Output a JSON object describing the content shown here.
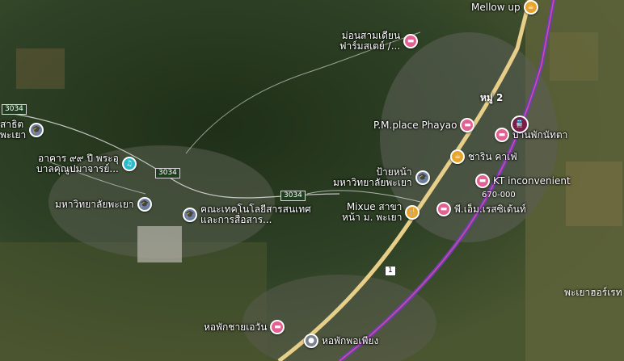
{
  "colors": {
    "hotel": "#e26191",
    "education": "#6d7f9c",
    "food": "#e8a32b",
    "music": "#2bbbc9",
    "transit": "#7b1d4a",
    "place": "#7a8290",
    "highway": "#e7cf8a",
    "rail": "#6b3fb8"
  },
  "icons": {
    "hotel": "bed-icon",
    "education": "graduation-cap-icon",
    "food": "fork-knife-icon",
    "music": "music-note-icon",
    "transit": "train-icon",
    "place": "place-pin-icon"
  },
  "road_shields": [
    "3034",
    "3034",
    "3034"
  ],
  "route_marker": "1",
  "places": {
    "mellow_up": "Mellow up",
    "monsam": "ม่อนสามเดียน\nฟาร์มสเตย์ /...",
    "moo2": "หมู่ 2",
    "pm_place": "P.M.place Phayao",
    "ban_pak": "บ้านพักนัทตา",
    "charin": "ชาริน คาเฟ่",
    "kt": "KT inconvenient",
    "kt_price": "670-000",
    "pai_na": "ป้ายหน้า\nมหาวิทยาลัยพะเยา",
    "mixue": "Mixue สาขา\nหน้า ม. พะเยา",
    "pe_resident": "พี.เอ็ม.เรสซิเด้นท์",
    "sathit": "สาธิต\nพะเยา",
    "aakan": "อาคาร ๙๙ ปี พระอุ\nบาลคุณูปมาจารย์...",
    "mahawit": "มหาวิทยาลัยพะเยา",
    "khana": "คณะเทคโนโลยีสารสนเทศ\nและการสื่อสาร...",
    "hopak_chai": "หอพักชายเอวัน",
    "hopak_pho": "หอพักพอเพียง",
    "phayao_heart": "พะเยาฮอร์เรท"
  }
}
